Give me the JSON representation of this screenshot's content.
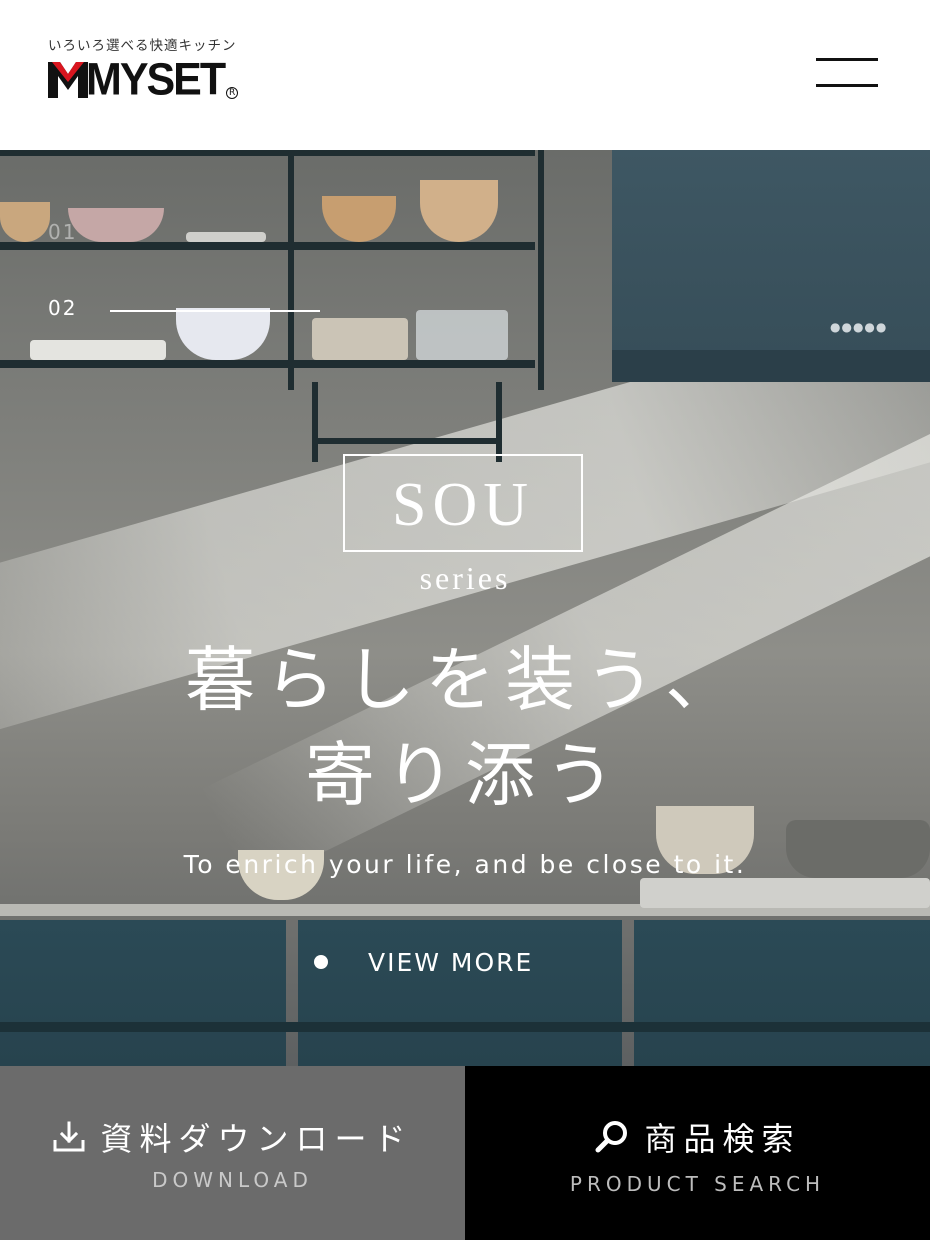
{
  "header": {
    "tagline": "いろいろ選べる快適キッチン",
    "logo_text": "MYSET",
    "logo_reg": "R"
  },
  "hero": {
    "slide_numbers": [
      "01",
      "02"
    ],
    "active_slide": "02",
    "sou_title": "SOU",
    "series_label": "series",
    "headline_line1": "暮らしを装う、",
    "headline_line2": "寄り添う",
    "subline": "To enrich your life, and be close to it.",
    "view_more_label": "VIEW MORE",
    "hood_dots": "●●●●●"
  },
  "footer_buttons": {
    "download": {
      "label_jp": "資料ダウンロード",
      "label_en": "DOWNLOAD",
      "icon": "download-icon"
    },
    "search": {
      "label_jp": "商品検索",
      "label_en": "PRODUCT SEARCH",
      "icon": "search-icon"
    }
  },
  "colors": {
    "logo_red": "#d9161f",
    "download_bg": "#6b6b6b",
    "search_bg": "#000000",
    "cabinet": "#2b4a56"
  }
}
